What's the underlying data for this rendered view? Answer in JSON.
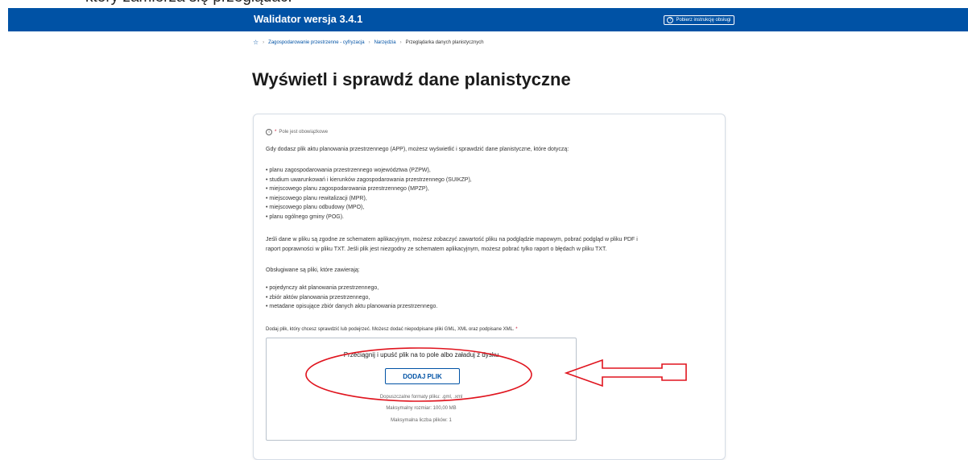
{
  "doc_top_text": "który zamierza się przeglądać.",
  "header": {
    "title": "Walidator wersja 3.4.1",
    "manual_button": "Pobierz instrukcję obsługi"
  },
  "breadcrumb": {
    "items": [
      "Zagospodarowanie przestrzenne - cyfryzacja",
      "Narzędzia"
    ],
    "current": "Przeglądarka danych planistycznych"
  },
  "page_title": "Wyświetl i sprawdź dane planistyczne",
  "form": {
    "required_note": "Pole jest obowiązkowe",
    "intro": "Gdy dodasz plik aktu planowania przestrzennego (APP), możesz wyświetlić i sprawdzić dane planistyczne, które dotyczą:",
    "plan_types": [
      "• planu zagospodarowania przestrzennego województwa (PZPW),",
      "• studium uwarunkowań i kierunków zagospodarowania przestrzennego (SUIKZP),",
      "• miejscowego planu zagospodarowania przestrzennego (MPZP),",
      "• miejscowego planu rewitalizacji (MPR),",
      "• miejscowego planu odbudowy (MPO),",
      "• planu ogólnego gminy (POG)."
    ],
    "schema_info_line1": "Jeśli dane w pliku są zgodne ze schematem aplikacyjnym, możesz zobaczyć zawartość pliku na podglądzie mapowym, pobrać podgląd w pliku PDF i",
    "schema_info_line2": "raport poprawności w pliku TXT. Jeśli plik jest niezgodny ze schematem aplikacyjnym, możesz pobrać tylko raport o błędach w pliku TXT.",
    "supported_heading": "Obsługiwane są pliki, które zawierają:",
    "supported_items": [
      "• pojedynczy akt planowania przestrzennego,",
      "• zbiór aktów planowania przestrzennego,",
      "• metadane opisujące zbiór danych aktu planowania przestrzennego."
    ],
    "file_field_label": "Dodaj plik, który chcesz sprawdzić lub podejrzeć. Możesz dodać niepodpisane pliki GML, XML oraz podpisane XML.",
    "dropzone": {
      "instruction": "Przeciągnij i upuść plik na to pole albo załaduj z dysku",
      "add_button": "DODAJ PLIK",
      "formats": "Dopuszczalne formaty pliku: .gml, .xml",
      "max_size": "Maksymalny rozmiar: 100,00 MB",
      "max_files": "Maksymalna liczba plików: 1"
    }
  },
  "colors": {
    "header_bg": "#0052a5",
    "accent": "#0052a5",
    "annotation": "#e0141e",
    "required": "#c8102e"
  }
}
